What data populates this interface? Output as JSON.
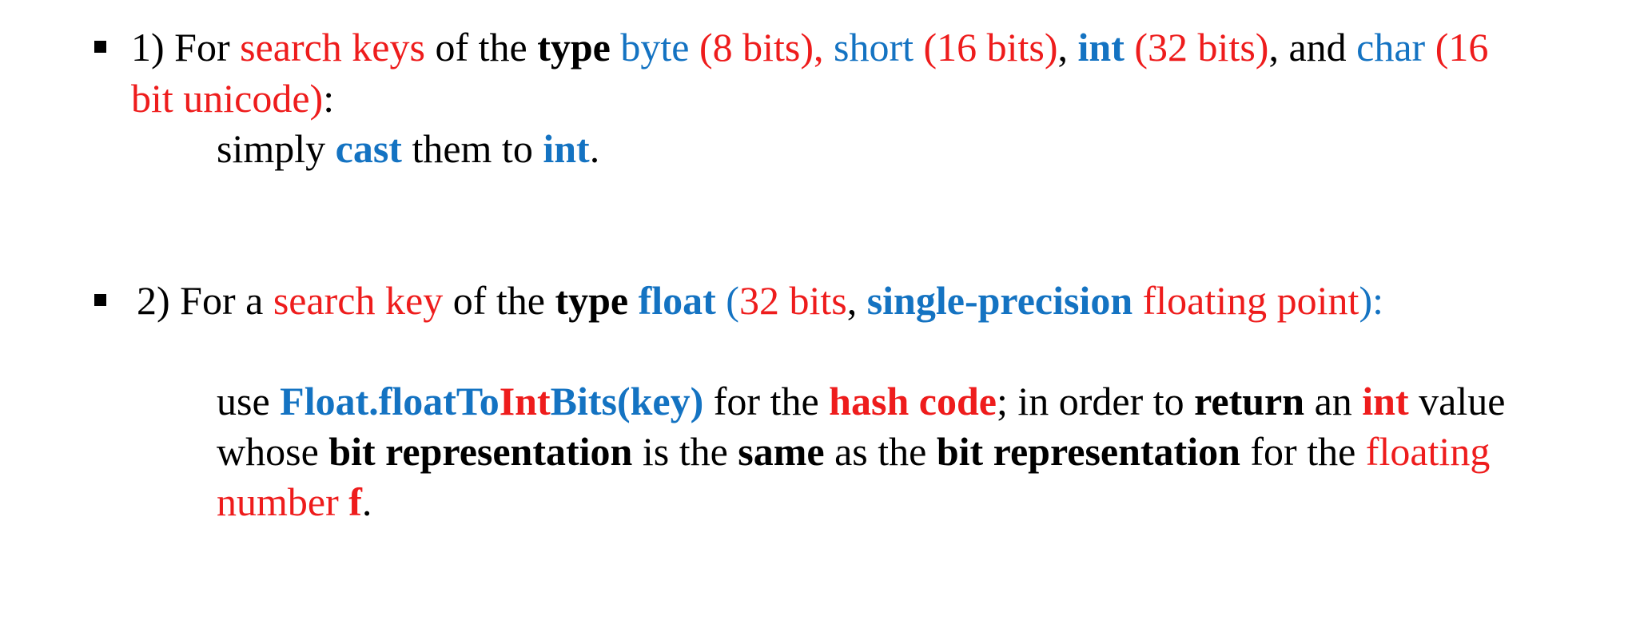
{
  "colors": {
    "text": "#000000",
    "red": "#ee1c1c",
    "blue": "#1473c2",
    "background": "#ffffff"
  },
  "bullet1": {
    "line1": [
      {
        "text": "1) For ",
        "color": "text",
        "bold": false
      },
      {
        "text": "search keys",
        "color": "red",
        "bold": false
      },
      {
        "text": " of the ",
        "color": "text",
        "bold": false
      },
      {
        "text": "type",
        "color": "text",
        "bold": true
      },
      {
        "text": " ",
        "color": "text",
        "bold": false
      },
      {
        "text": "byte",
        "color": "blue",
        "bold": false
      },
      {
        "text": " (8 bits),",
        "color": "red",
        "bold": false
      },
      {
        "text": " short",
        "color": "blue",
        "bold": false
      },
      {
        "text": " (16 bits)",
        "color": "red",
        "bold": false
      },
      {
        "text": ", ",
        "color": "text",
        "bold": false
      },
      {
        "text": "int",
        "color": "blue",
        "bold": true
      },
      {
        "text": " (32 bits)",
        "color": "red",
        "bold": false
      },
      {
        "text": ", and ",
        "color": "text",
        "bold": false
      },
      {
        "text": "char",
        "color": "blue",
        "bold": false
      },
      {
        "text": " (16",
        "color": "red",
        "bold": false
      }
    ],
    "line2": [
      {
        "text": "bit unicode)",
        "color": "red",
        "bold": false
      },
      {
        "text": ":",
        "color": "text",
        "bold": false
      }
    ],
    "line3": [
      {
        "text": "simply ",
        "color": "text",
        "bold": false
      },
      {
        "text": "cast",
        "color": "blue",
        "bold": true
      },
      {
        "text": " them to ",
        "color": "text",
        "bold": false
      },
      {
        "text": "int",
        "color": "blue",
        "bold": true
      },
      {
        "text": ".",
        "color": "text",
        "bold": false
      }
    ]
  },
  "bullet2": {
    "line1": [
      {
        "text": "2) For a ",
        "color": "text",
        "bold": false
      },
      {
        "text": "search key",
        "color": "red",
        "bold": false
      },
      {
        "text": " of the ",
        "color": "text",
        "bold": false
      },
      {
        "text": "type",
        "color": "text",
        "bold": true
      },
      {
        "text": " ",
        "color": "text",
        "bold": false
      },
      {
        "text": "float",
        "color": "blue",
        "bold": true
      },
      {
        "text": " (",
        "color": "blue",
        "bold": false
      },
      {
        "text": "32 bits",
        "color": "red",
        "bold": false
      },
      {
        "text": ", ",
        "color": "text",
        "bold": false
      },
      {
        "text": "single-precision",
        "color": "blue",
        "bold": true
      },
      {
        "text": " floating point",
        "color": "red",
        "bold": false
      },
      {
        "text": "):",
        "color": "blue",
        "bold": false
      }
    ],
    "line2": [
      {
        "text": "use ",
        "color": "text",
        "bold": false
      },
      {
        "text": "Float.floatTo",
        "color": "blue",
        "bold": true
      },
      {
        "text": "Int",
        "color": "red",
        "bold": true
      },
      {
        "text": "Bits(key)",
        "color": "blue",
        "bold": true
      },
      {
        "text": " for the ",
        "color": "text",
        "bold": false
      },
      {
        "text": "hash code",
        "color": "red",
        "bold": true
      },
      {
        "text": "; in order to ",
        "color": "text",
        "bold": false
      },
      {
        "text": "return",
        "color": "text",
        "bold": true
      },
      {
        "text": " an ",
        "color": "text",
        "bold": false
      },
      {
        "text": "int",
        "color": "red",
        "bold": true
      },
      {
        "text": " value",
        "color": "text",
        "bold": false
      }
    ],
    "line3": [
      {
        "text": "whose ",
        "color": "text",
        "bold": false
      },
      {
        "text": "bit representation",
        "color": "text",
        "bold": true
      },
      {
        "text": " is the ",
        "color": "text",
        "bold": false
      },
      {
        "text": "same",
        "color": "text",
        "bold": true
      },
      {
        "text": " as the ",
        "color": "text",
        "bold": false
      },
      {
        "text": "bit representation",
        "color": "text",
        "bold": true
      },
      {
        "text": " for the ",
        "color": "text",
        "bold": false
      },
      {
        "text": "floating",
        "color": "red",
        "bold": false
      }
    ],
    "line4": [
      {
        "text": "number ",
        "color": "red",
        "bold": false
      },
      {
        "text": "f",
        "color": "red",
        "bold": true
      },
      {
        "text": ".",
        "color": "text",
        "bold": false
      }
    ]
  }
}
